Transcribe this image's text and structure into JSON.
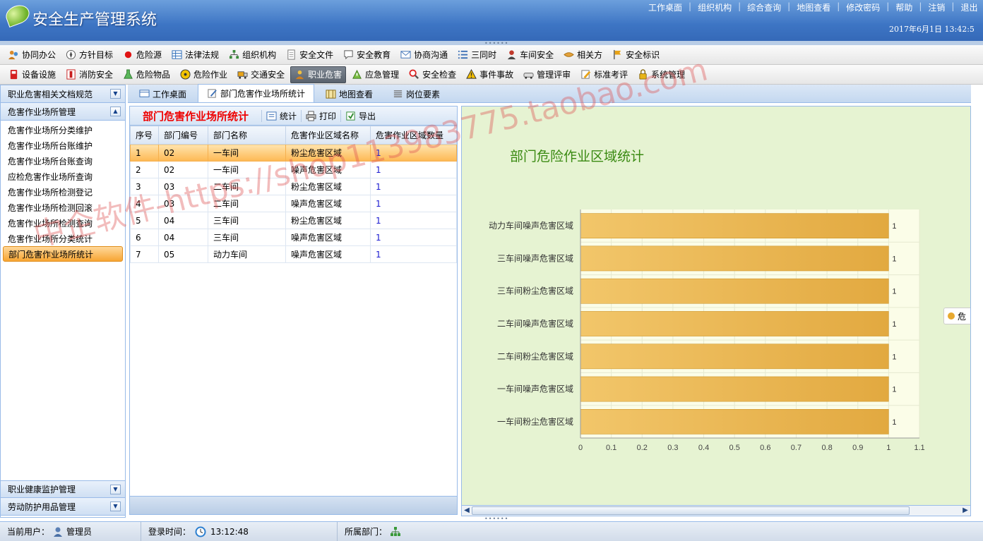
{
  "header": {
    "title": "安全生产管理系统",
    "links": [
      "工作桌面",
      "组织机构",
      "综合查询",
      "地图查看",
      "修改密码",
      "帮助",
      "注销",
      "退出"
    ],
    "datetime": "2017年6月1日  13:42:5"
  },
  "toolbar1": [
    {
      "label": "协同办公",
      "icon": "people-icon"
    },
    {
      "label": "方针目标",
      "icon": "compass-icon"
    },
    {
      "label": "危险源",
      "icon": "red-dot-icon"
    },
    {
      "label": "法律法规",
      "icon": "table-icon"
    },
    {
      "label": "组织机构",
      "icon": "org-icon"
    },
    {
      "label": "安全文件",
      "icon": "document-icon"
    },
    {
      "label": "安全教育",
      "icon": "speech-icon"
    },
    {
      "label": "协商沟通",
      "icon": "mail-icon"
    },
    {
      "label": "三同时",
      "icon": "list-icon"
    },
    {
      "label": "车间安全",
      "icon": "user-icon"
    },
    {
      "label": "相关方",
      "icon": "handshake-icon"
    },
    {
      "label": "安全标识",
      "icon": "flag-icon"
    }
  ],
  "toolbar2": [
    {
      "label": "设备设施",
      "icon": "device-icon"
    },
    {
      "label": "消防安全",
      "icon": "extinguisher-icon"
    },
    {
      "label": "危险物品",
      "icon": "flask-icon"
    },
    {
      "label": "危险作业",
      "icon": "hazard-icon"
    },
    {
      "label": "交通安全",
      "icon": "truck-icon"
    },
    {
      "label": "职业危害",
      "icon": "worker-icon",
      "selected": true
    },
    {
      "label": "应急管理",
      "icon": "emergency-icon"
    },
    {
      "label": "安全检查",
      "icon": "magnifier-icon"
    },
    {
      "label": "事件事故",
      "icon": "warning-icon"
    },
    {
      "label": "管理评审",
      "icon": "car-icon"
    },
    {
      "label": "标准考评",
      "icon": "pencil-icon"
    },
    {
      "label": "系统管理",
      "icon": "lock-icon"
    }
  ],
  "sidebar": {
    "sections": [
      {
        "label": "职业危害相关文档规范",
        "toggle": "▼"
      },
      {
        "label": "危害作业场所管理",
        "toggle": "▲"
      }
    ],
    "items": [
      {
        "label": "危害作业场所分类维护"
      },
      {
        "label": "危害作业场所台账维护"
      },
      {
        "label": "危害作业场所台账查询"
      },
      {
        "label": "应检危害作业场所查询"
      },
      {
        "label": "危害作业场所检测登记"
      },
      {
        "label": "危害作业场所检测回滚"
      },
      {
        "label": "危害作业场所检测查询"
      },
      {
        "label": "危害作业场所分类统计"
      },
      {
        "label": "部门危害作业场所统计",
        "selected": true
      }
    ],
    "bottom_sections": [
      {
        "label": "职业健康监护管理",
        "toggle": "▼"
      },
      {
        "label": "劳动防护用品管理",
        "toggle": "▼"
      }
    ]
  },
  "tabs": [
    {
      "label": "工作桌面",
      "icon": "desktop-icon"
    },
    {
      "label": "部门危害作业场所统计",
      "icon": "edit-icon",
      "active": true
    },
    {
      "label": "地图查看",
      "icon": "map-icon"
    },
    {
      "label": "岗位要素",
      "icon": "lines-icon"
    }
  ],
  "leftpane": {
    "title": "部门危害作业场所统计",
    "buttons": [
      {
        "label": "统计",
        "icon": "stats-icon"
      },
      {
        "label": "打印",
        "icon": "printer-icon"
      },
      {
        "label": "导出",
        "icon": "export-icon"
      }
    ],
    "columns": [
      "序号",
      "部门编号",
      "部门名称",
      "危害作业区域名称",
      "危害作业区域数量"
    ],
    "rows": [
      [
        "1",
        "02",
        "一车间",
        "粉尘危害区域",
        "1"
      ],
      [
        "2",
        "02",
        "一车间",
        "噪声危害区域",
        "1"
      ],
      [
        "3",
        "03",
        "二车间",
        "粉尘危害区域",
        "1"
      ],
      [
        "4",
        "03",
        "二车间",
        "噪声危害区域",
        "1"
      ],
      [
        "5",
        "04",
        "三车间",
        "粉尘危害区域",
        "1"
      ],
      [
        "6",
        "04",
        "三车间",
        "噪声危害区域",
        "1"
      ],
      [
        "7",
        "05",
        "动力车间",
        "噪声危害区域",
        "1"
      ]
    ]
  },
  "chart_data": {
    "type": "bar",
    "orientation": "horizontal",
    "title": "部门危险作业区域统计",
    "categories": [
      "动力车间噪声危害区域",
      "三车间噪声危害区域",
      "三车间粉尘危害区域",
      "二车间噪声危害区域",
      "二车间粉尘危害区域",
      "一车间噪声危害区域",
      "一车间粉尘危害区域"
    ],
    "series": [
      {
        "name": "危",
        "values": [
          1,
          1,
          1,
          1,
          1,
          1,
          1
        ]
      }
    ],
    "xlim": [
      0,
      1.1
    ],
    "xticks": [
      "0",
      "0.1",
      "0.2",
      "0.3",
      "0.4",
      "0.5",
      "0.6",
      "0.7",
      "0.8",
      "0.9",
      "1",
      "1.1"
    ],
    "data_labels": [
      "1",
      "1",
      "1",
      "1",
      "1",
      "1",
      "1"
    ],
    "legend_position": "right",
    "bar_color": "#e2a940",
    "grid": true
  },
  "watermark": "中企软件-https://shop113983775.taobao.com",
  "statusbar": {
    "user_label": "当前用户：",
    "user": "管理员",
    "login_label": "登录时间：",
    "login_time": "13:12:48",
    "dept_label": "所属部门："
  }
}
